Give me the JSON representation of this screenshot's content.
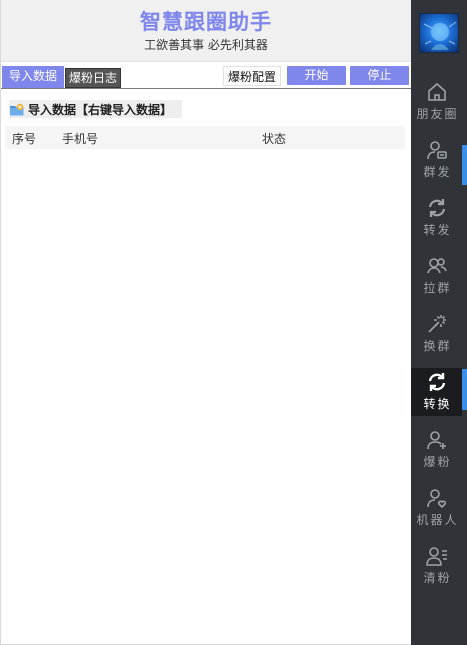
{
  "header": {
    "title": "智慧跟圈助手",
    "subtitle": "工欲善其事 必先利其器"
  },
  "toolbar": {
    "tab_import": "导入数据",
    "tab_log": "爆粉日志",
    "config_label": "爆粉配置",
    "start_label": "开始",
    "stop_label": "停止"
  },
  "import_hint": {
    "label": "导入数据【右键导入数据】",
    "icon": "folder-import-icon"
  },
  "table": {
    "columns": [
      "序号",
      "手机号",
      "状态"
    ],
    "rows": []
  },
  "sidebar": {
    "items": [
      {
        "label": "朋友圈",
        "icon": "home-icon"
      },
      {
        "label": "群发",
        "icon": "user-message-icon"
      },
      {
        "label": "转发",
        "icon": "refresh-icon"
      },
      {
        "label": "拉群",
        "icon": "group-icon"
      },
      {
        "label": "换群",
        "icon": "magic-wand-icon"
      },
      {
        "label": "转换",
        "icon": "refresh-icon",
        "active": true
      },
      {
        "label": "爆粉",
        "icon": "user-add-icon"
      },
      {
        "label": "机器人",
        "icon": "user-heart-icon"
      },
      {
        "label": "清粉",
        "icon": "user-list-icon"
      }
    ]
  },
  "colors": {
    "accent": "#7f86ec",
    "sidebar_bg": "#303439",
    "sidebar_active_bg": "#1a1c1f",
    "sidebar_marker": "#3b8ee8"
  }
}
